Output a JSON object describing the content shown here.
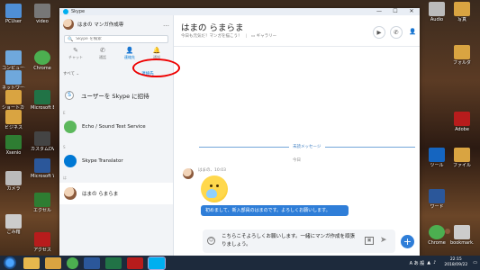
{
  "desktop": {
    "left_icons": [
      {
        "label": "PCUser",
        "color": "#4f8fd6"
      },
      {
        "label": "コンピューター",
        "color": "#6fa8dc"
      },
      {
        "label": "ネットワーク",
        "color": "#6fa8dc"
      },
      {
        "label": "ショートカット",
        "color": "#d9a441"
      },
      {
        "label": "ビジネス",
        "color": "#d9a441"
      },
      {
        "label": "Xsenio",
        "color": "#2e7d32"
      },
      {
        "label": "カメラ",
        "color": "#bbbbbb"
      },
      {
        "label": "ごみ箱",
        "color": "#cccccc"
      },
      {
        "label": "カスタムDVD",
        "color": "#444444"
      },
      {
        "label": "エクセル",
        "color": "#2e7d32"
      },
      {
        "label": "アクセス",
        "color": "#b71c1c"
      }
    ],
    "mid_icons": [
      {
        "label": "video",
        "color": "#777777"
      },
      {
        "label": "Microsoft Word",
        "color": "#2b579a"
      },
      {
        "label": "Microsoft Excel",
        "color": "#217346"
      },
      {
        "label": "Chrome",
        "color": "#4caf50"
      }
    ],
    "right_icons": [
      {
        "label": "Audio",
        "color": "#bbbbbb"
      },
      {
        "label": "写真",
        "color": "#d9a441"
      },
      {
        "label": "フォルダ",
        "color": "#d9a441"
      },
      {
        "label": "Adobe",
        "color": "#b71c1c"
      },
      {
        "label": "ツール",
        "color": "#1565c0"
      },
      {
        "label": "ファイル",
        "color": "#d9a441"
      },
      {
        "label": "ワード",
        "color": "#2b579a"
      },
      {
        "label": "bookmark.html",
        "color": "#cccccc"
      },
      {
        "label": "Chrome",
        "color": "#4caf50"
      }
    ]
  },
  "window": {
    "title": "Skype",
    "controls": {
      "minimize": "—",
      "maximize": "☐",
      "close": "✕"
    }
  },
  "sidebar": {
    "profile_name": "はまの マンガ作成専",
    "more": "…",
    "search_placeholder": "Skype を検索",
    "tabs": [
      {
        "icon": "✎",
        "label": "チャット"
      },
      {
        "icon": "✆",
        "label": "通話"
      },
      {
        "icon": "👤",
        "label": "連絡先"
      },
      {
        "icon": "🔔",
        "label": "通知"
      }
    ],
    "filter": "すべて ⌄",
    "new_contact": "+ 連絡先",
    "invite": "ユーザーを Skype に招待",
    "section_e": "E",
    "section_s": "S",
    "section_ha": "は",
    "contacts": [
      {
        "name": "Echo / Sound Test Service",
        "avatar_color": "#5cb85c"
      },
      {
        "name": "Skype Translator",
        "avatar_color": "#0078d4"
      },
      {
        "name": "はまの らまらま",
        "avatar_color": "#8b5a3c"
      }
    ]
  },
  "chat": {
    "contact_name": "はまの らまらま",
    "subtitle": "今日も元気だ！マンガを描こう！",
    "gallery": "ギャラリー",
    "unread_label": "未読メッセージ",
    "today_label": "今日",
    "message_meta": "はまの、10:03",
    "message_text": "初めまして、新入部員のはまのです。よろしくお願いします。",
    "compose_text": "こちらこそよろしくお願いします。一緒にマンガ作成を頑張りましょう。",
    "accent": "#2f7ed8"
  },
  "taskbar": {
    "tray_ime": "A あ 般",
    "time": "22:15",
    "date": "2018/09/22",
    "apps": [
      {
        "color": "#e6b84d"
      },
      {
        "color": "#d9a441"
      },
      {
        "color": "#4caf50"
      },
      {
        "color": "#2b579a"
      },
      {
        "color": "#217346"
      },
      {
        "color": "#b71c1c"
      },
      {
        "color": "#00aff0"
      }
    ]
  }
}
